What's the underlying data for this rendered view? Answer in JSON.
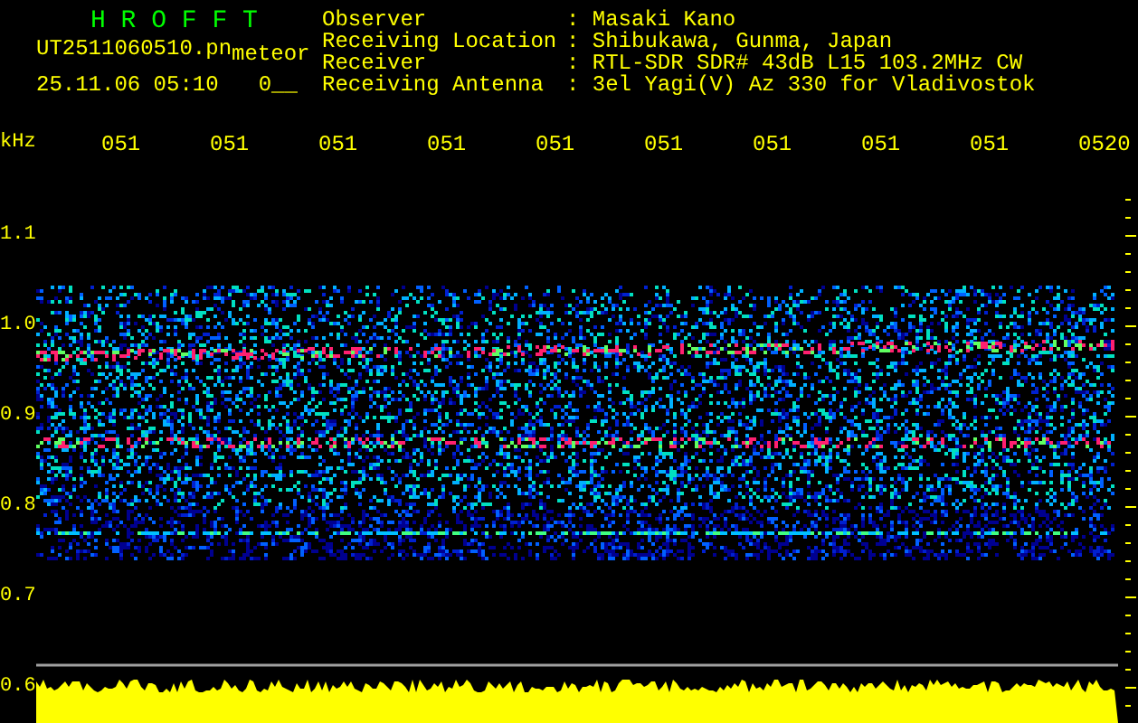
{
  "app_title": "H R O F F T",
  "file_name": "UT2511060510.pn",
  "mode": "meteor",
  "date_time": "25.11.06 05:10",
  "counter": "0__",
  "info": [
    {
      "label": "Observer",
      "value": ": Masaki Kano"
    },
    {
      "label": "Receiving Location",
      "value": ": Shibukawa, Gunma, Japan"
    },
    {
      "label": "Receiver",
      "value": ": RTL-SDR SDR# 43dB L15 103.2MHz CW"
    },
    {
      "label": "Receiving Antenna",
      "value": ": 3el Yagi(V) Az 330 for Vladivostok"
    }
  ],
  "unit": "kHz",
  "time_labels": [
    "051",
    "051",
    "051",
    "051",
    "051",
    "051",
    "051",
    "051",
    "051",
    "0520"
  ],
  "freq_labels": [
    "1.1",
    "1.0",
    "0.9",
    "0.8",
    "0.7",
    "0.6"
  ]
}
